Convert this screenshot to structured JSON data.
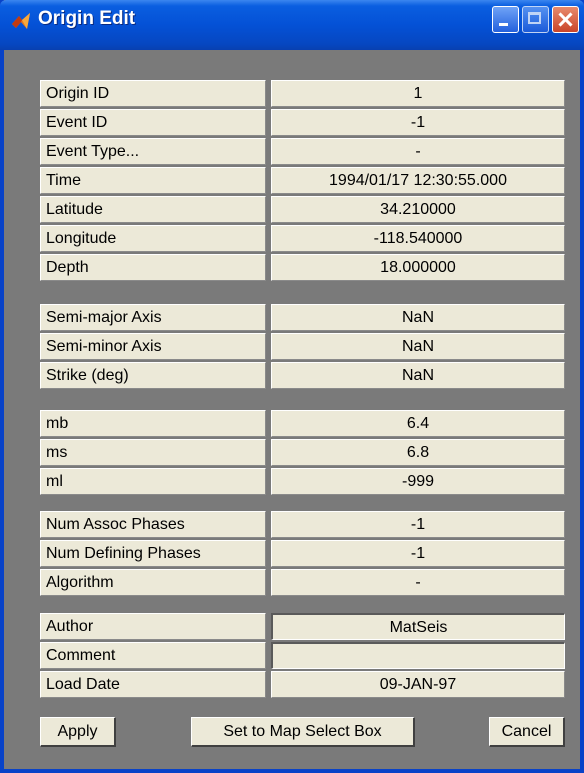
{
  "window": {
    "title": "Origin Edit"
  },
  "groups": {
    "g1": [
      {
        "label": "Origin ID",
        "value": "1"
      },
      {
        "label": "Event ID",
        "value": "-1"
      },
      {
        "label": "Event Type...",
        "value": "-"
      },
      {
        "label": "Time",
        "value": "1994/01/17 12:30:55.000"
      },
      {
        "label": "Latitude",
        "value": "34.210000"
      },
      {
        "label": "Longitude",
        "value": "-118.540000"
      },
      {
        "label": "Depth",
        "value": "18.000000"
      }
    ],
    "g2": [
      {
        "label": "Semi-major Axis",
        "value": "NaN"
      },
      {
        "label": "Semi-minor Axis",
        "value": "NaN"
      },
      {
        "label": "Strike (deg)",
        "value": "NaN"
      }
    ],
    "g3": [
      {
        "label": "mb",
        "value": "6.4"
      },
      {
        "label": "ms",
        "value": "6.8"
      },
      {
        "label": "ml",
        "value": "-999"
      }
    ],
    "g4": [
      {
        "label": "Num Assoc Phases",
        "value": "-1"
      },
      {
        "label": "Num Defining Phases",
        "value": "-1"
      },
      {
        "label": "Algorithm",
        "value": "-"
      }
    ],
    "g5": [
      {
        "label": "Author",
        "value": "MatSeis"
      },
      {
        "label": "Comment",
        "value": ""
      },
      {
        "label": "Load Date",
        "value": "09-JAN-97"
      }
    ]
  },
  "buttons": {
    "apply": "Apply",
    "map_select": "Set to Map Select Box",
    "cancel": "Cancel"
  }
}
